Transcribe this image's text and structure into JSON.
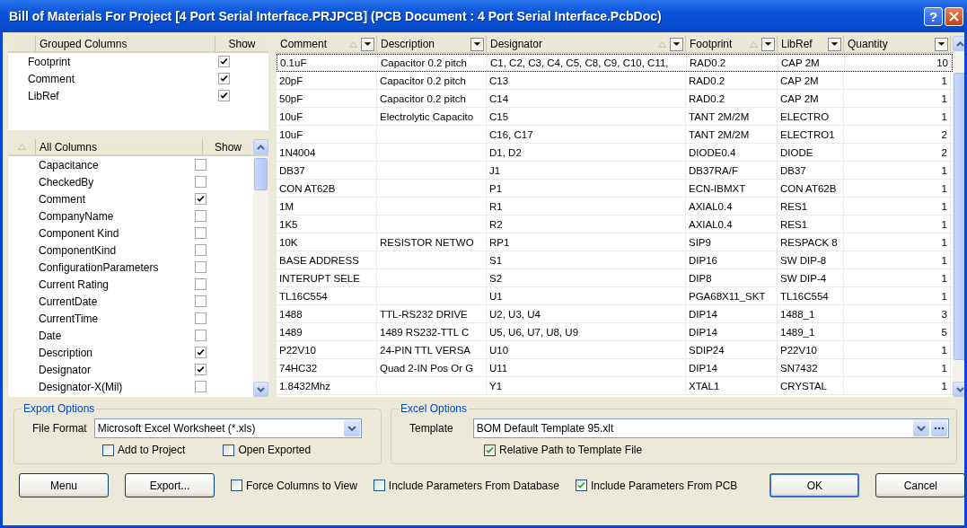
{
  "window": {
    "title": "Bill of Materials For Project [4 Port Serial Interface.PRJPCB] (PCB Document : 4 Port Serial Interface.PcbDoc)",
    "help_button": "?"
  },
  "grouped_columns": {
    "header": "Grouped Columns",
    "show_header": "Show",
    "items": [
      {
        "name": "Footprint",
        "show": true
      },
      {
        "name": "Comment",
        "show": true
      },
      {
        "name": "LibRef",
        "show": true
      }
    ]
  },
  "all_columns": {
    "header": "All Columns",
    "show_header": "Show",
    "items": [
      {
        "name": "Capacitance",
        "show": false
      },
      {
        "name": "CheckedBy",
        "show": false
      },
      {
        "name": "Comment",
        "show": true
      },
      {
        "name": "CompanyName",
        "show": false
      },
      {
        "name": "Component Kind",
        "show": false
      },
      {
        "name": "ComponentKind",
        "show": false
      },
      {
        "name": "ConfigurationParameters",
        "show": false
      },
      {
        "name": "Current Rating",
        "show": false
      },
      {
        "name": "CurrentDate",
        "show": false
      },
      {
        "name": "CurrentTime",
        "show": false
      },
      {
        "name": "Date",
        "show": false
      },
      {
        "name": "Description",
        "show": true
      },
      {
        "name": "Designator",
        "show": true
      },
      {
        "name": "Designator-X(Mil)",
        "show": false
      }
    ]
  },
  "grid": {
    "columns": [
      {
        "label": "Comment",
        "sorted": true
      },
      {
        "label": "Description",
        "sorted": false
      },
      {
        "label": "Designator",
        "sorted": true
      },
      {
        "label": "Footprint",
        "sorted": true
      },
      {
        "label": "LibRef",
        "sorted": false
      },
      {
        "label": "Quantity",
        "sorted": false
      }
    ],
    "rows": [
      {
        "focused": true,
        "cells": [
          "0.1uF",
          "Capacitor 0.2 pitch",
          "C1, C2, C3, C4, C5, C8, C9, C10, C11,",
          "RAD0.2",
          "CAP 2M",
          "10"
        ]
      },
      {
        "focused": false,
        "cells": [
          "20pF",
          "Capacitor 0.2 pitch",
          "C13",
          "RAD0.2",
          "CAP 2M",
          "1"
        ]
      },
      {
        "focused": false,
        "cells": [
          "50pF",
          "Capacitor 0.2 pitch",
          "C14",
          "RAD0.2",
          "CAP 2M",
          "1"
        ]
      },
      {
        "focused": false,
        "cells": [
          "10uF",
          "Electrolytic Capacito",
          "C15",
          "TANT 2M/2M",
          "ELECTRO",
          "1"
        ]
      },
      {
        "focused": false,
        "cells": [
          "10uF",
          "",
          "C16, C17",
          "TANT 2M/2M",
          "ELECTRO1",
          "2"
        ]
      },
      {
        "focused": false,
        "cells": [
          "1N4004",
          "",
          "D1, D2",
          "DIODE0.4",
          "DIODE",
          "2"
        ]
      },
      {
        "focused": false,
        "cells": [
          "DB37",
          "",
          "J1",
          "DB37RA/F",
          "DB37",
          "1"
        ]
      },
      {
        "focused": false,
        "cells": [
          "CON AT62B",
          "",
          "P1",
          "ECN-IBMXT",
          "CON AT62B",
          "1"
        ]
      },
      {
        "focused": false,
        "cells": [
          "1M",
          "",
          "R1",
          "AXIAL0.4",
          "RES1",
          "1"
        ]
      },
      {
        "focused": false,
        "cells": [
          "1K5",
          "",
          "R2",
          "AXIAL0.4",
          "RES1",
          "1"
        ]
      },
      {
        "focused": false,
        "cells": [
          "10K",
          "RESISTOR NETWO",
          "RP1",
          "SIP9",
          "RESPACK 8",
          "1"
        ]
      },
      {
        "focused": false,
        "cells": [
          "BASE ADDRESS",
          "",
          "S1",
          "DIP16",
          "SW DIP-8",
          "1"
        ]
      },
      {
        "focused": false,
        "cells": [
          "INTERUPT SELE",
          "",
          "S2",
          "DIP8",
          "SW DIP-4",
          "1"
        ]
      },
      {
        "focused": false,
        "cells": [
          "TL16C554",
          "",
          "U1",
          "PGA68X11_SKT",
          "TL16C554",
          "1"
        ]
      },
      {
        "focused": false,
        "cells": [
          "1488",
          "TTL-RS232 DRIVE",
          "U2, U3, U4",
          "DIP14",
          "1488_1",
          "3"
        ]
      },
      {
        "focused": false,
        "cells": [
          "1489",
          "1489 RS232-TTL C",
          "U5, U6, U7, U8, U9",
          "DIP14",
          "1489_1",
          "5"
        ]
      },
      {
        "focused": false,
        "cells": [
          "P22V10",
          "24-PIN TTL VERSA",
          "U10",
          "SDIP24",
          "P22V10",
          "1"
        ]
      },
      {
        "focused": false,
        "cells": [
          "74HC32",
          "Quad 2-IN Pos Or G",
          "U11",
          "DIP14",
          "SN7432",
          "1"
        ]
      },
      {
        "focused": false,
        "cells": [
          "1.8432Mhz",
          "",
          "Y1",
          "XTAL1",
          "CRYSTAL",
          "1"
        ]
      }
    ]
  },
  "export_options": {
    "title": "Export Options",
    "file_format_label": "File Format",
    "file_format": "Microsoft Excel Worksheet (*.xls)",
    "checkboxes": [
      {
        "label": "Add to Project",
        "checked": false
      },
      {
        "label": "Open Exported",
        "checked": false
      }
    ]
  },
  "excel_options": {
    "title": "Excel Options",
    "template_label": "Template",
    "template": "BOM Default Template 95.xlt",
    "checkboxes": [
      {
        "label": "Relative Path to Template File",
        "checked": true
      }
    ]
  },
  "footer": [
    {
      "kind": "button",
      "label": "Menu",
      "default": false
    },
    {
      "kind": "button",
      "label": "Export...",
      "default": false
    },
    {
      "kind": "checkbox",
      "label": "Force Columns to View",
      "checked": false
    },
    {
      "kind": "checkbox",
      "label": "Include Parameters From Database",
      "checked": false
    },
    {
      "kind": "checkbox",
      "label": "Include Parameters From PCB",
      "checked": true
    },
    {
      "kind": "button",
      "label": "OK",
      "default": true
    },
    {
      "kind": "button",
      "label": "Cancel",
      "default": false
    }
  ]
}
